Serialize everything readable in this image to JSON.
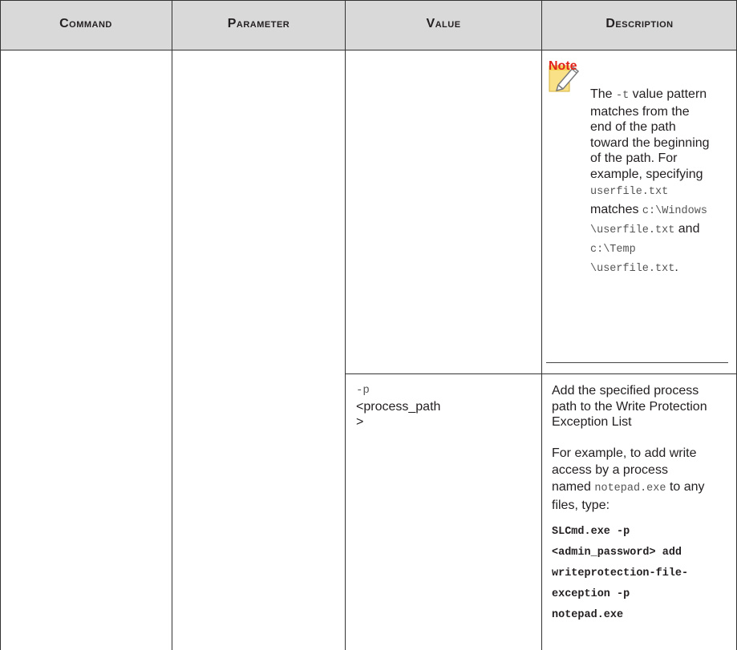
{
  "header": {
    "command": "Command",
    "parameter": "Parameter",
    "value": "Value",
    "description": "Description"
  },
  "row1": {
    "note": {
      "title": "Note",
      "icon": "note-pencil-icon",
      "lines": [
        "The -t value pattern",
        "matches from the",
        "end of the path",
        "toward the beginning",
        "of the path. For",
        "example, specifying",
        "userfile.txt",
        "matches c:\\Windows",
        "\\userfile.txt and",
        "c:\\Temp",
        "\\userfile.txt."
      ],
      "parts": {
        "the": "The ",
        "t_flag": "-t",
        "value_pattern": " value pattern",
        "userfile": "userfile.txt",
        "matches": "matches ",
        "c_windows": "c:\\Windows",
        "userfile_path": "\\userfile.txt",
        "and": " and",
        "c_temp": "c:\\Temp",
        "temp_userfile": "\\userfile.txt",
        "period": "."
      }
    }
  },
  "row2": {
    "value_flag": "-p",
    "value_arg_line1": "<process_path",
    "value_arg_line2": ">",
    "desc1_lines": [
      "Add the specified process",
      "path to the Write Protection",
      "Exception List"
    ],
    "desc2": {
      "line1": "For example, to add write",
      "line2": "access by a process",
      "line3_prefix": "named ",
      "line3_code": "notepad.exe",
      "line3_suffix": " to any",
      "line4": "files, type:"
    },
    "command_lines": [
      "SLCmd.exe -p",
      "<admin_password> add",
      "writeprotection-file-",
      "exception -p",
      "notepad.exe"
    ]
  }
}
